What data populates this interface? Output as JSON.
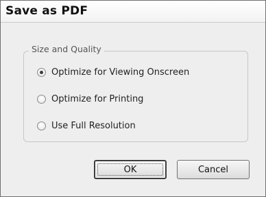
{
  "dialog": {
    "title": "Save as PDF",
    "group": {
      "legend": "Size and Quality",
      "options": [
        {
          "label": "Optimize for Viewing Onscreen",
          "selected": true
        },
        {
          "label": "Optimize for Printing",
          "selected": false
        },
        {
          "label": "Use Full Resolution",
          "selected": false
        }
      ]
    },
    "buttons": {
      "ok": "OK",
      "cancel": "Cancel"
    }
  }
}
